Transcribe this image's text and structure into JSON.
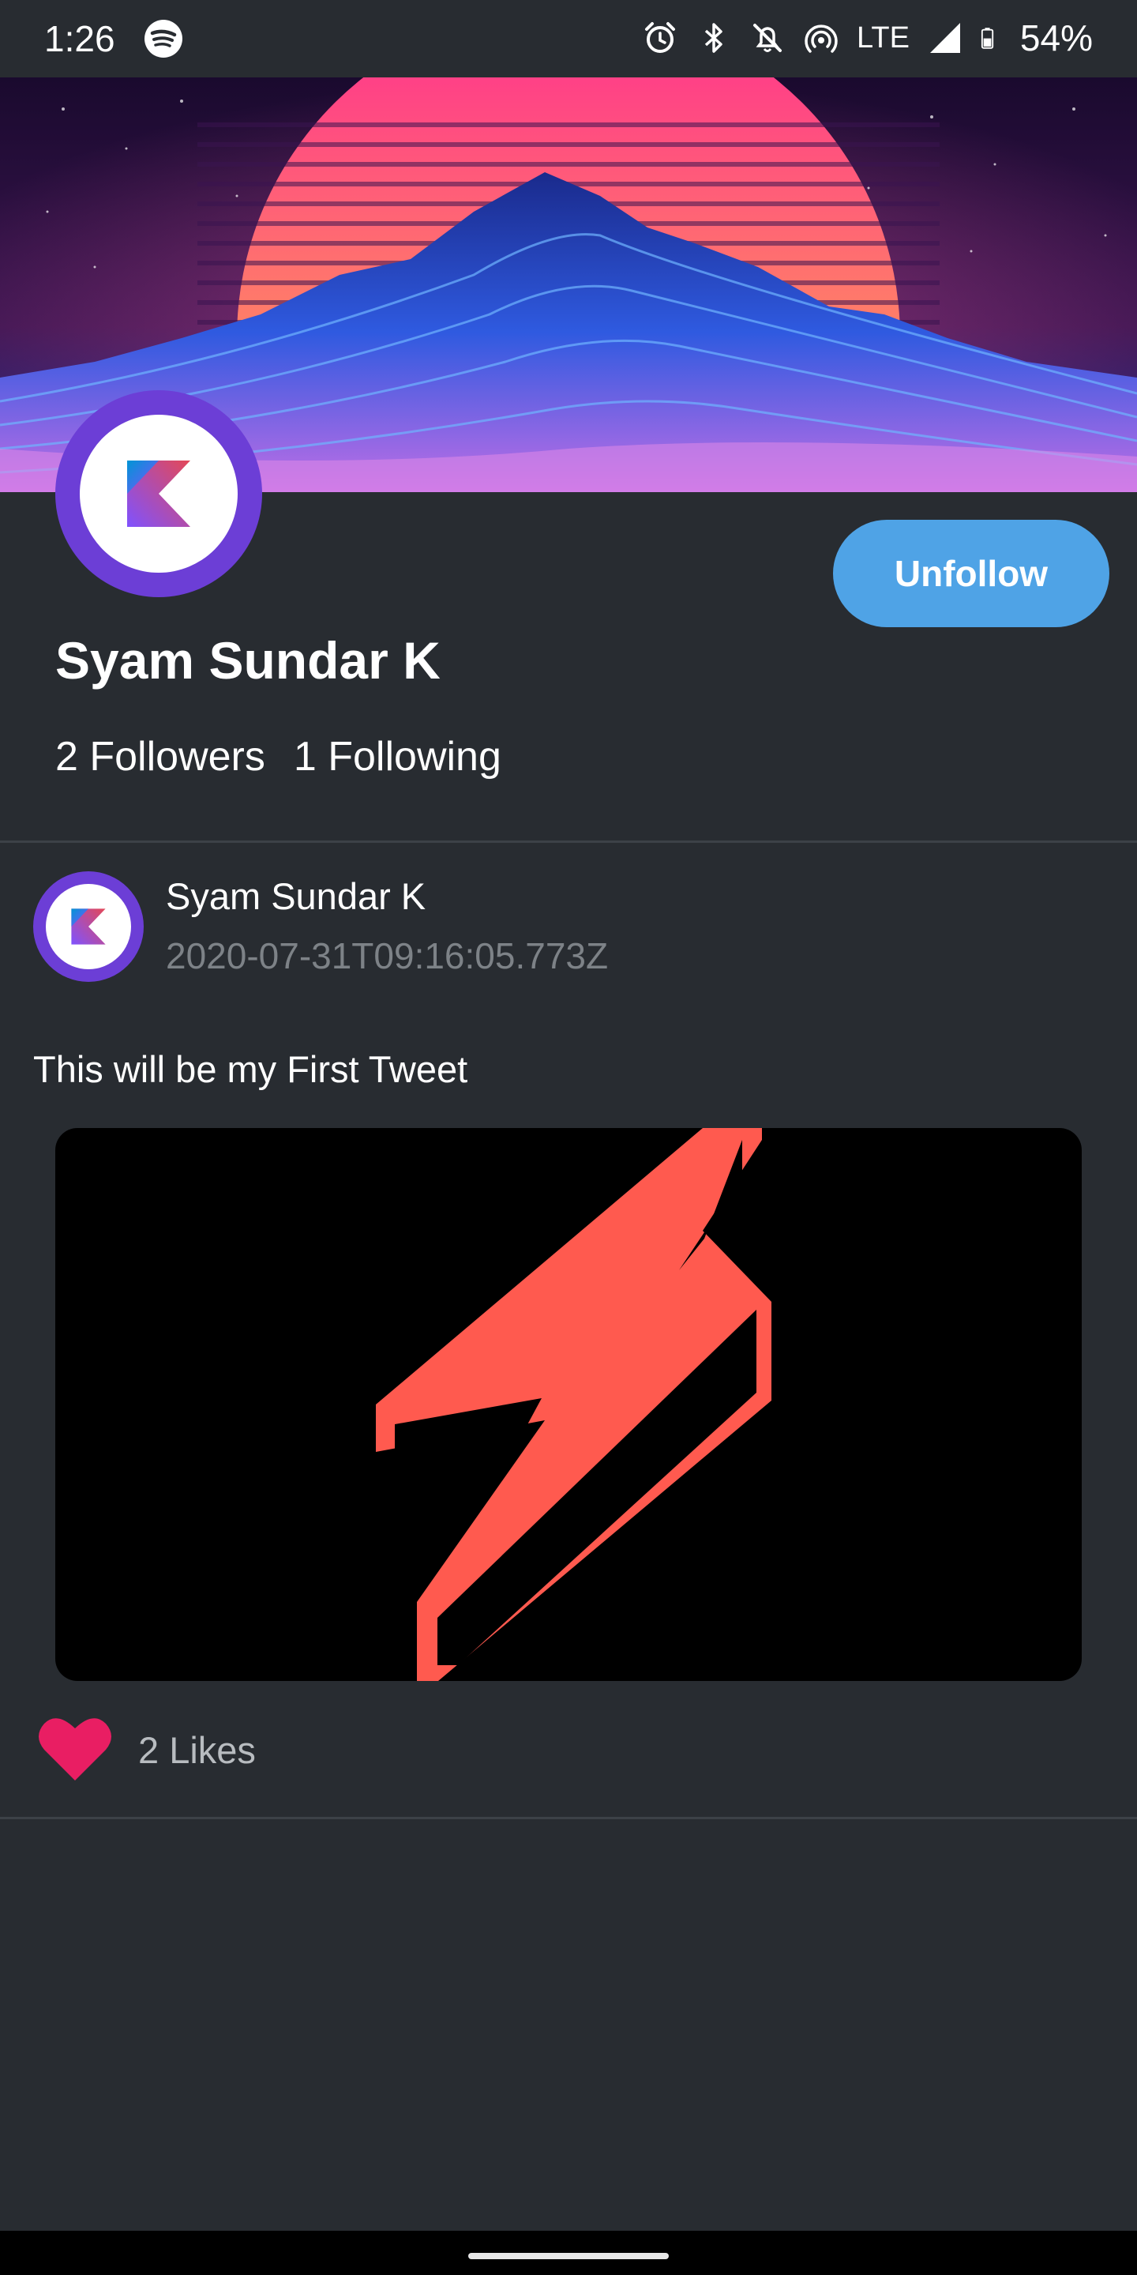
{
  "status_bar": {
    "time": "1:26",
    "network": "LTE",
    "battery": "54%",
    "icons": [
      "spotify-icon",
      "alarm-icon",
      "bluetooth-icon",
      "notifications-off-icon",
      "hotspot-icon",
      "signal-icon",
      "battery-icon"
    ]
  },
  "profile": {
    "name": "Syam Sundar K",
    "followers": "2 Followers",
    "following": "1 Following",
    "unfollow_label": "Unfollow",
    "avatar_icon": "kotlin-logo-icon",
    "banner": "synthwave-sunset-mountains"
  },
  "tweet": {
    "author": "Syam Sundar K",
    "timestamp": "2020-07-31T09:16:05.773Z",
    "text": "This will be my First Tweet",
    "media_icon": "lightning-bolt-icon",
    "likes": "2 Likes"
  },
  "colors": {
    "background": "#282c31",
    "accent": "#4fa3e6",
    "avatar_ring": "#6c3ed6",
    "like": "#e91e63",
    "bolt": "#ff5a4f",
    "muted_text": "#7d8287"
  }
}
